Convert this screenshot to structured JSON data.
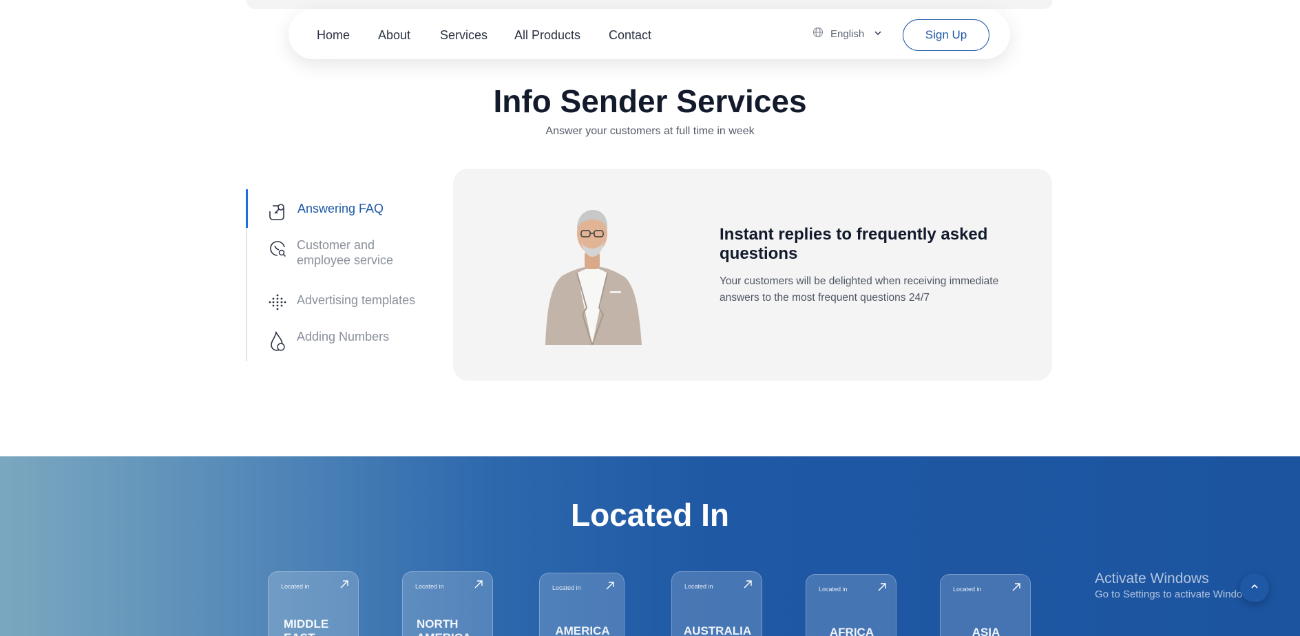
{
  "nav": {
    "links": [
      "Home",
      "About",
      "Services",
      "All Products",
      "Contact"
    ],
    "language": "English",
    "signup_label": "Sign Up"
  },
  "section": {
    "title": "Info Sender Services",
    "subtitle": "Answer your customers at full time in week"
  },
  "tabs": [
    {
      "label": "Answering FAQ",
      "icon": "chat-key-icon",
      "active": true
    },
    {
      "label": "Customer and employee service",
      "icon": "support-search-icon",
      "active": false
    },
    {
      "label": "Advertising templates",
      "icon": "dots-grid-icon",
      "active": false
    },
    {
      "label": "Adding Numbers",
      "icon": "flame-icon",
      "active": false
    }
  ],
  "card": {
    "title": "Instant replies to frequently asked questions",
    "description": "Your customers will be delighted when receiving immediate answers to the most frequent questions 24/7"
  },
  "located": {
    "title": "Located In",
    "card_caption": "Located in",
    "regions": [
      "MIDDLE EAST",
      "NORTH AMERICA",
      "AMERICA",
      "AUSTRALIA",
      "AFRICA",
      "ASIA"
    ]
  },
  "windows": {
    "line1": "Activate Windows",
    "line2": "Go to Settings to activate Windows."
  },
  "colors": {
    "accent": "#1f59a6",
    "active_tab": "#1e6fd9",
    "banner": "#1c54a0"
  }
}
